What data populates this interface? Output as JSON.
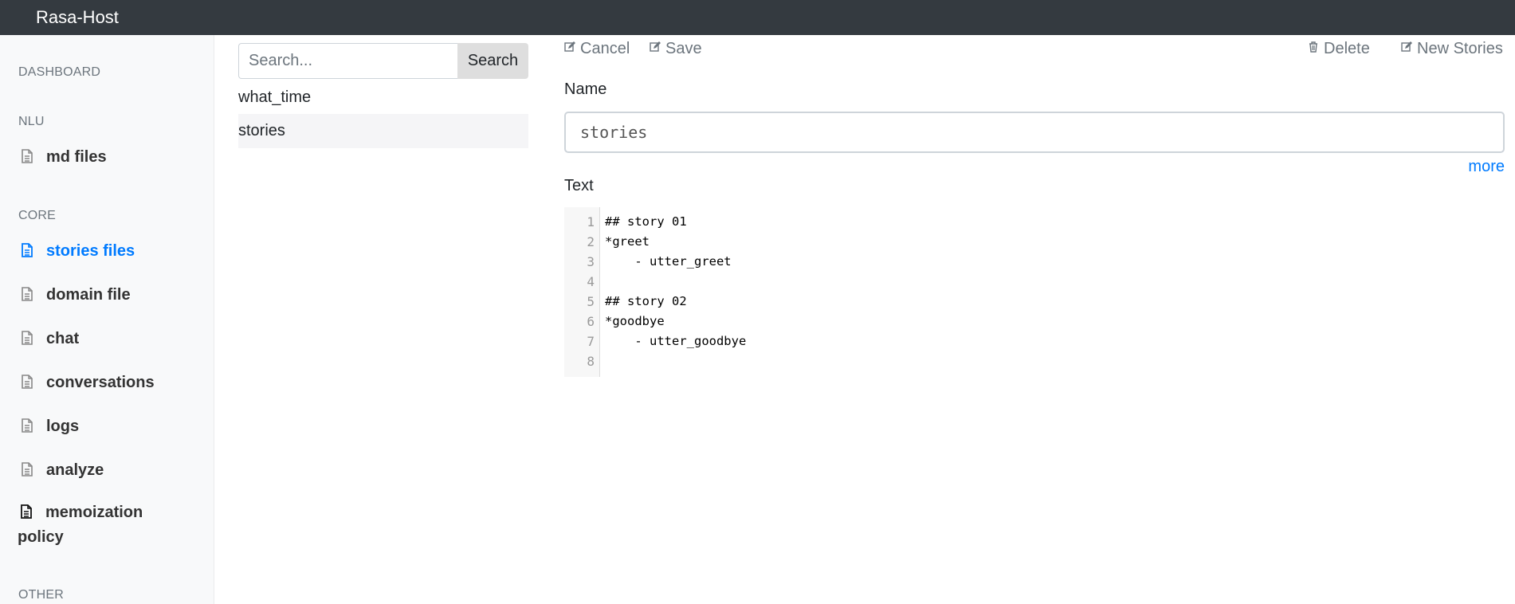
{
  "app": {
    "title": "Rasa-Host"
  },
  "sidebar": {
    "sections": [
      {
        "heading": "DASHBOARD"
      },
      {
        "heading": "NLU"
      },
      {
        "heading": "CORE"
      },
      {
        "heading": "OTHER"
      }
    ],
    "items": [
      {
        "label": "md files",
        "icon": "file-text-icon",
        "active": false
      },
      {
        "label": "stories files",
        "icon": "file-text-icon",
        "active": true
      },
      {
        "label": "domain file",
        "icon": "file-text-icon",
        "active": false
      },
      {
        "label": "chat",
        "icon": "file-text-icon",
        "active": false
      },
      {
        "label": "conversations",
        "icon": "file-text-icon",
        "active": false
      },
      {
        "label": "logs",
        "icon": "file-text-icon",
        "active": false
      },
      {
        "label": "analyze",
        "icon": "file-text-icon",
        "active": false
      },
      {
        "label": "memoization policy",
        "icon": "file-text-icon",
        "active": false
      }
    ]
  },
  "search": {
    "placeholder": "Search...",
    "value": "",
    "button_label": "Search"
  },
  "file_list": [
    {
      "label": "what_time",
      "selected": false
    },
    {
      "label": "stories",
      "selected": true
    }
  ],
  "toolbar": {
    "cancel_label": "Cancel",
    "save_label": "Save",
    "delete_label": "Delete",
    "new_label": "New Stories"
  },
  "editor": {
    "name_label": "Name",
    "name_value": "stories",
    "more_label": "more",
    "text_label": "Text",
    "line_numbers": [
      "1",
      "2",
      "3",
      "4",
      "5",
      "6",
      "7",
      "8"
    ],
    "lines": [
      "## story 01",
      "*greet",
      "    - utter_greet",
      "",
      "## story 02",
      "*goodbye",
      "    - utter_goodbye",
      ""
    ]
  },
  "colors": {
    "navbar": "#343a40",
    "accent": "#007bff",
    "sidebar_bg": "#f8f9fa",
    "muted": "#6c757d"
  }
}
